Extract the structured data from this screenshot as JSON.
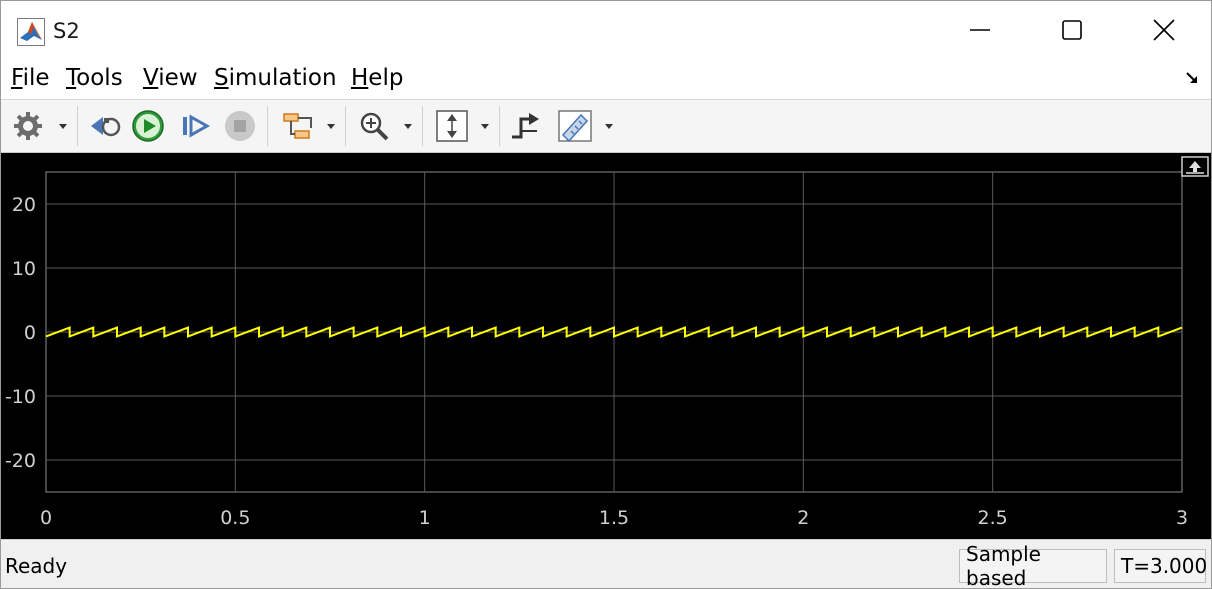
{
  "window": {
    "title": "S2"
  },
  "menu": [
    {
      "key": "F",
      "rest": "ile"
    },
    {
      "key": "T",
      "rest": "ools"
    },
    {
      "key": "V",
      "rest": "iew"
    },
    {
      "key": "S",
      "rest": "imulation"
    },
    {
      "key": "H",
      "rest": "elp"
    }
  ],
  "toolbar": {
    "icons": [
      "gear-icon",
      "step-back-icon",
      "run-icon",
      "step-forward-icon",
      "stop-icon",
      "signal-select-icon",
      "zoom-icon",
      "scale-axes-icon",
      "triggers-icon",
      "measurements-icon"
    ]
  },
  "status": {
    "text": "Ready",
    "mode": "Sample based",
    "time": "T=3.000"
  },
  "colors": {
    "plot_background": "#000000",
    "grid": "#5a5a5a",
    "trace": "#ffff00",
    "tick_text": "#d0d0d0"
  },
  "chart_data": {
    "type": "line",
    "xlim": [
      0,
      3
    ],
    "ylim": [
      -25,
      25
    ],
    "xticks": [
      0,
      0.5,
      1,
      1.5,
      2,
      2.5,
      3
    ],
    "xtick_labels": [
      "0",
      "0.5",
      "1",
      "1.5",
      "2",
      "2.5",
      "3"
    ],
    "yticks": [
      20,
      10,
      0,
      -10,
      -20
    ],
    "ytick_labels": [
      "20",
      "10",
      "0",
      "-10",
      "-20"
    ],
    "grid": true,
    "series": [
      {
        "waveform": "sawtooth",
        "period": 0.0625,
        "min": -0.7,
        "max": 0.7
      }
    ]
  }
}
